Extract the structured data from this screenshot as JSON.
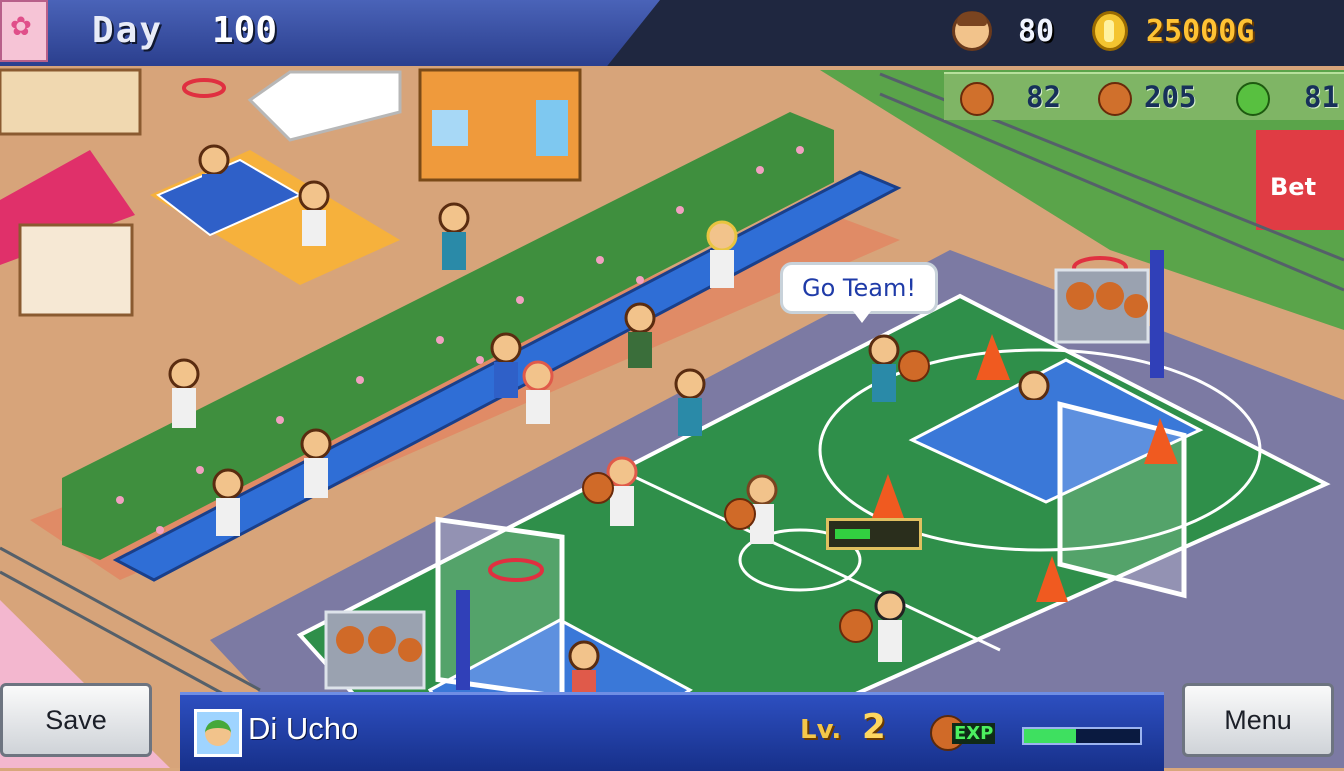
{
  "header": {
    "day_label": "Day",
    "day_value": "100",
    "population_value": "80",
    "gold_value": "25000G",
    "icons": [
      "calendar-icon",
      "population-icon",
      "coin-icon"
    ]
  },
  "resources": [
    {
      "icon": "food-icon",
      "value": "82",
      "color": "#d0702c"
    },
    {
      "icon": "basketball-icon",
      "value": "205",
      "color": "#d0702c"
    },
    {
      "icon": "research-icon",
      "value": "81",
      "color": "#58c040"
    }
  ],
  "scene": {
    "speech_bubble": "Go Team!",
    "sign_text": "Bet",
    "skill_progress": 0.45
  },
  "footer": {
    "save_label": "Save",
    "menu_label": "Menu",
    "character_name": "Di Ucho",
    "level_label": "Lv.",
    "level_value": "2",
    "exp_label": "EXP",
    "exp_progress": 0.45
  },
  "colors": {
    "court_green": "#2f8f4a",
    "paint_blue": "#3a78d8",
    "status_bar": "#2d4fc0",
    "gold_text": "#ffc234"
  }
}
